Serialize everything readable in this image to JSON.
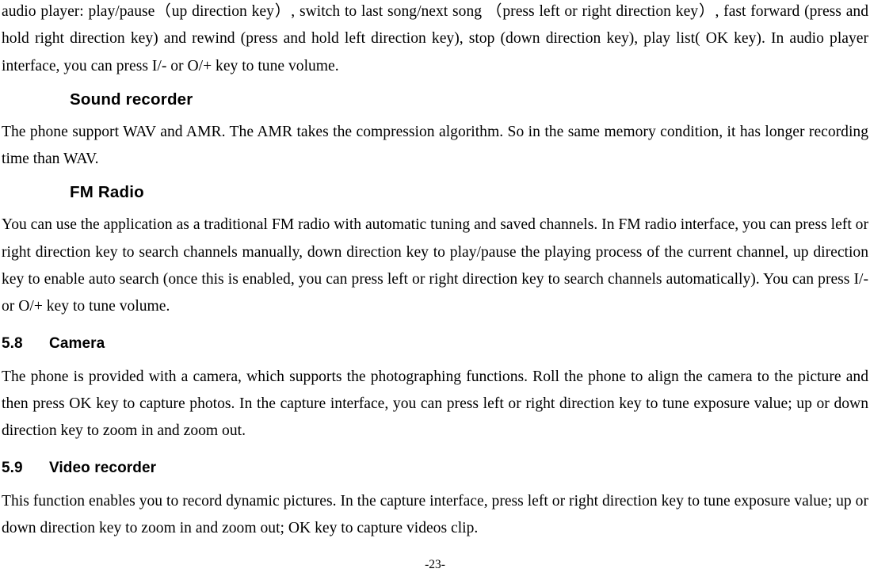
{
  "document": {
    "type": "user-manual-page",
    "page_label": "-23-",
    "background_color": "#ffffff",
    "text_color": "#000000"
  },
  "blocks": [
    {
      "kind": "paragraph",
      "id": "audio-player-paragraph",
      "text": "audio player: play/pause（up direction key）, switch to last song/next song （press left or right direction key）, fast forward (press and hold right direction key) and rewind (press and hold left direction key), stop (down direction key), play list( OK key). In audio player interface, you can press I/- or O/+ key to tune volume."
    },
    {
      "kind": "heading3",
      "id": "sound-recorder-heading",
      "text": "Sound recorder"
    },
    {
      "kind": "paragraph",
      "id": "sound-recorder-paragraph",
      "text": "The phone support WAV and AMR. The AMR takes the compression algorithm. So in the same memory condition, it has longer recording time than WAV."
    },
    {
      "kind": "heading3",
      "id": "fm-radio-heading",
      "text": "FM Radio"
    },
    {
      "kind": "paragraph",
      "id": "fm-radio-paragraph",
      "text": "You can use the application as a traditional FM radio with automatic tuning and saved channels. In FM radio interface, you can press left or right direction key to search channels manually, down direction key to play/pause the playing process of the current channel, up direction key to enable auto search (once this is enabled, you can press left or right direction key to search channels automatically). You can press I/- or O/+ key to tune volume."
    },
    {
      "kind": "heading2",
      "id": "camera-heading",
      "number": "5.8",
      "title": "Camera"
    },
    {
      "kind": "paragraph",
      "id": "camera-paragraph",
      "text": "The phone is provided with a camera, which supports the photographing functions. Roll the phone to align the camera to the picture and then press OK key to capture photos. In the capture interface, you can press left or right direction key to tune exposure value; up or down direction key to zoom in and zoom out."
    },
    {
      "kind": "heading2",
      "id": "video-recorder-heading",
      "number": "5.9",
      "title": "Video recorder"
    },
    {
      "kind": "paragraph",
      "id": "video-recorder-paragraph",
      "text": "This function enables you to record dynamic pictures. In the capture interface, press left or right direction key to tune exposure value; up or down direction key to zoom in and zoom out; OK key to capture videos clip."
    }
  ],
  "headings": {
    "sound_recorder": "Sound recorder",
    "fm_radio": "FM Radio",
    "camera_number": "5.8",
    "camera_title": "Camera",
    "video_recorder_number": "5.9",
    "video_recorder_title": "Video recorder"
  },
  "paragraphs": {
    "audio_player": "audio player: play/pause（up direction key）, switch to last song/next song （press left or right direction key）, fast forward (press and hold right direction key) and rewind (press and hold left direction key), stop (down direction key), play list( OK key). In audio player interface, you can press I/- or O/+ key to tune volume.",
    "sound_recorder": "The phone support WAV and AMR. The AMR takes the compression algorithm. So in the same memory condition, it has longer recording time than WAV.",
    "fm_radio": "You can use the application as a traditional FM radio with automatic tuning and saved channels. In FM radio interface, you can press left or right direction key to search channels manually, down direction key to play/pause the playing process of the current channel, up direction key to enable auto search (once this is enabled, you can press left or right direction key to search channels automatically). You can press I/- or O/+ key to tune volume.",
    "camera": "The phone is provided with a camera, which supports the photographing functions. Roll the phone to align the camera to the picture and then press OK key to capture photos. In the capture interface, you can press left or right direction key to tune exposure value; up or down direction key to zoom in and zoom out.",
    "video_recorder": "This function enables you to record dynamic pictures. In the capture interface, press left or right direction key to tune exposure value; up or down direction key to zoom in and zoom out; OK key to capture videos clip."
  },
  "footer": {
    "page_number": "-23-"
  }
}
